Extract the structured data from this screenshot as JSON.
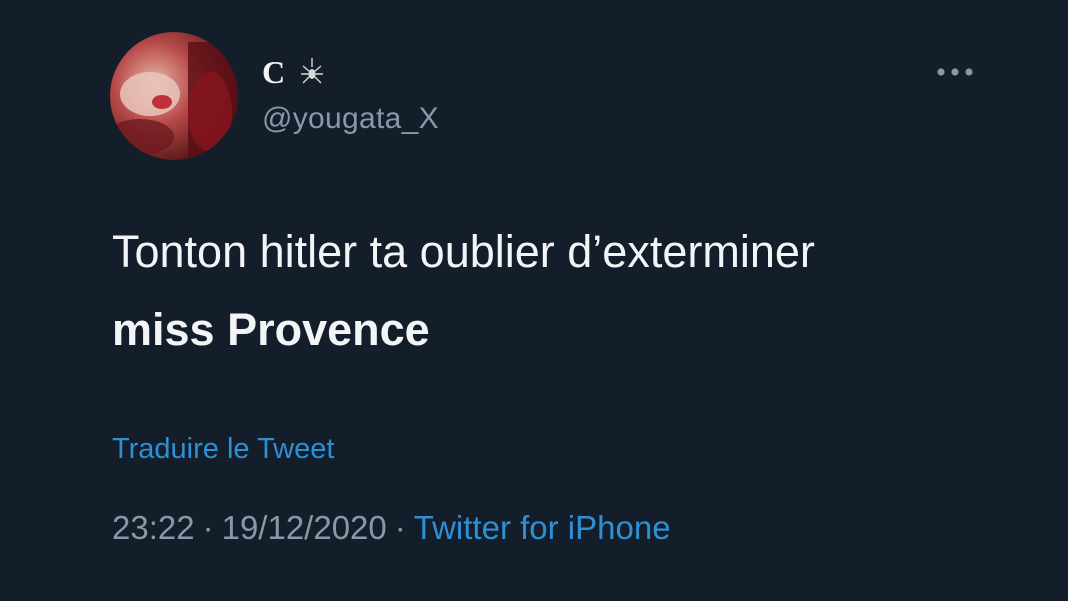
{
  "author": {
    "display_name": "C",
    "handle": "@yougata_X",
    "avatar_icon": "profile-photo",
    "name_emoji_icon": "spider-icon"
  },
  "tweet": {
    "text_line_1": "Tonton hitler ta oublier d’exterminer",
    "text_line_2": "miss Provence",
    "translate_label": "Traduire le Tweet",
    "time": "23:22",
    "date": "19/12/2020",
    "separator": "·",
    "source": "Twitter for iPhone"
  },
  "menu": {
    "more_icon": "more-horizontal-icon"
  },
  "colors": {
    "background": "#141d2a",
    "text": "#f3f4f5",
    "muted": "#8899a6",
    "link": "#2d8fd4"
  }
}
